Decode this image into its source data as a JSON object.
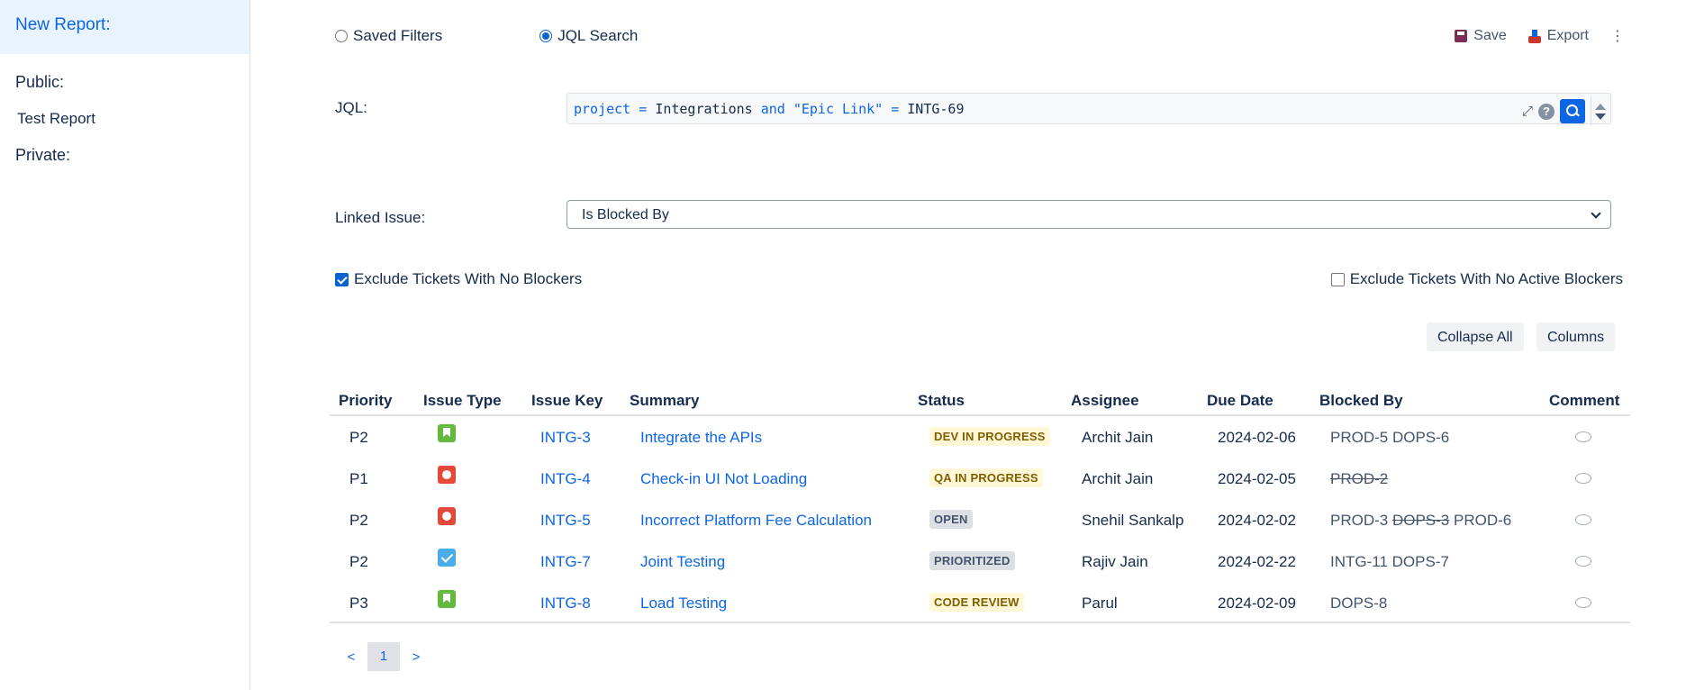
{
  "sidebar": {
    "new_report": "New Report:",
    "public_heading": "Public:",
    "public_items": [
      "Test Report"
    ],
    "private_heading": "Private:"
  },
  "search_mode": {
    "saved_filters": "Saved Filters",
    "jql_search": "JQL Search",
    "selected": "jql_search"
  },
  "actions": {
    "save": "Save",
    "export": "Export",
    "more": "⋮"
  },
  "jql": {
    "label": "JQL:",
    "kw1": "project",
    "op1": "=",
    "val1": "Integrations",
    "kw2": "and",
    "str1": "\"Epic Link\"",
    "op2": "=",
    "val2": "INTG-69",
    "help": "?",
    "expand": "⤢"
  },
  "linked_issue": {
    "label": "Linked Issue:",
    "value": "Is Blocked By"
  },
  "filters": {
    "exclude_no_blockers": "Exclude Tickets With No Blockers",
    "exclude_no_blockers_checked": true,
    "exclude_no_active_blockers": "Exclude Tickets With No Active Blockers",
    "exclude_no_active_blockers_checked": false
  },
  "buttons": {
    "collapse_all": "Collapse All",
    "columns": "Columns"
  },
  "table": {
    "headers": {
      "priority": "Priority",
      "issue_type": "Issue Type",
      "issue_key": "Issue Key",
      "summary": "Summary",
      "status": "Status",
      "assignee": "Assignee",
      "due_date": "Due Date",
      "blocked_by": "Blocked By",
      "comment": "Comment"
    },
    "rows": [
      {
        "priority": "P2",
        "issue_type": "story",
        "key": "INTG-3",
        "summary": "Integrate the APIs",
        "status": "DEV IN PROGRESS",
        "status_color": "yellow",
        "assignee": "Archit Jain",
        "due": "2024-02-06",
        "blocked_by": [
          "PROD-5",
          "DOPS-6"
        ],
        "blocked_done": [
          false,
          false
        ]
      },
      {
        "priority": "P1",
        "issue_type": "bug",
        "key": "INTG-4",
        "summary": "Check-in UI Not Loading",
        "status": "QA IN PROGRESS",
        "status_color": "yellow",
        "assignee": "Archit Jain",
        "due": "2024-02-05",
        "blocked_by": [
          "PROD-2"
        ],
        "blocked_done": [
          true
        ]
      },
      {
        "priority": "P2",
        "issue_type": "bug",
        "key": "INTG-5",
        "summary": "Incorrect Platform Fee Calculation",
        "status": "OPEN",
        "status_color": "grey",
        "assignee": "Snehil Sankalp",
        "due": "2024-02-02",
        "blocked_by": [
          "PROD-3",
          "DOPS-3",
          "PROD-6"
        ],
        "blocked_done": [
          false,
          true,
          false
        ]
      },
      {
        "priority": "P2",
        "issue_type": "task",
        "key": "INTG-7",
        "summary": "Joint Testing",
        "status": "PRIORITIZED",
        "status_color": "grey",
        "assignee": "Rajiv Jain",
        "due": "2024-02-22",
        "blocked_by": [
          "INTG-11",
          "DOPS-7"
        ],
        "blocked_done": [
          false,
          false
        ]
      },
      {
        "priority": "P3",
        "issue_type": "story",
        "key": "INTG-8",
        "summary": "Load Testing",
        "status": "CODE REVIEW",
        "status_color": "yellow",
        "assignee": "Parul",
        "due": "2024-02-09",
        "blocked_by": [
          "DOPS-8"
        ],
        "blocked_done": [
          false
        ]
      }
    ]
  },
  "pagination": {
    "prev": "<",
    "current": "1",
    "next": ">"
  }
}
